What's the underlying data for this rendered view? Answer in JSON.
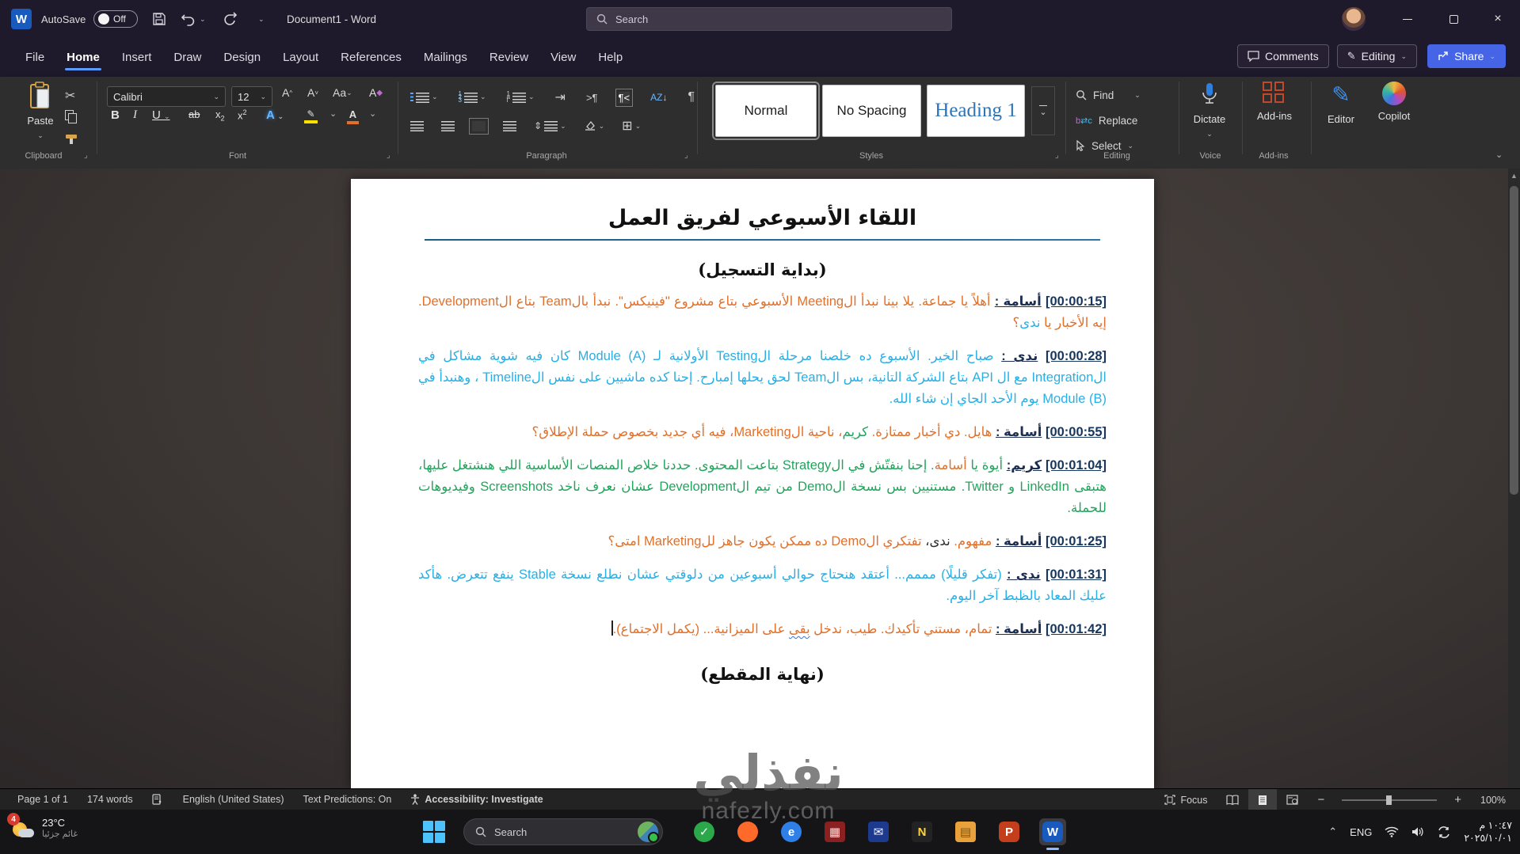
{
  "window": {
    "app_title": "Document1 - Word",
    "autosave_label": "AutoSave",
    "autosave_state": "Off",
    "search_placeholder": "Search",
    "word_badge": "W",
    "minimize": "–",
    "maximize": "▢",
    "close": "×"
  },
  "ribbon": {
    "tabs": [
      "File",
      "Home",
      "Insert",
      "Draw",
      "Design",
      "Layout",
      "References",
      "Mailings",
      "Review",
      "View",
      "Help"
    ],
    "active_tab": "Home",
    "comments_label": "Comments",
    "editing_mode_label": "Editing",
    "share_label": "Share",
    "paste_label": "Paste",
    "font_name": "Calibri",
    "font_size": "12",
    "styles": [
      {
        "label": "Normal",
        "selected": true
      },
      {
        "label": "No Spacing",
        "selected": false
      },
      {
        "label": "Heading 1",
        "selected": false,
        "heading": true
      }
    ],
    "editing_items": [
      "Find",
      "Replace",
      "Select"
    ],
    "dictate_label": "Dictate",
    "addins_label": "Add-ins",
    "editor_label": "Editor",
    "copilot_label": "Copilot",
    "group_labels": [
      "Clipboard",
      "Font",
      "Paragraph",
      "Styles",
      "Editing",
      "Voice",
      "Add-ins"
    ]
  },
  "document": {
    "title": "اللقاء الأسبوعي لفريق العمل",
    "section_start": "(بداية التسجيل)",
    "section_end": "(نهاية المقطع)",
    "paragraphs": [
      {
        "time": "[00:00:15]",
        "speaker": "أسامة :",
        "runs": [
          {
            "t": "أهلاً يا جماعة. يلا بينا نبدأ الMeeting الأسبوعي بتاع مشروع \"فينيكس\". نبدأ بالTeam بتاع الDevelopment. إيه الأخبار يا ",
            "c": "orange"
          },
          {
            "t": "ندى",
            "c": "cyan"
          },
          {
            "t": "؟",
            "c": "orange"
          }
        ]
      },
      {
        "time": "[00:00:28]",
        "speaker": "ندى :",
        "runs": [
          {
            "t": "صباح الخير. الأسبوع ده خلصنا مرحلة الTesting الأولانية لـ Module (A) كان فيه شوية مشاكل في الIntegration مع ال API بتاع الشركة التانية، بس الTeam لحق يحلها إمبارح. إحنا كده ماشيين على نفس الTimeline ، وهنبدأ في Module (B) يوم الأحد الجاي إن شاء الله.",
            "c": "cyan"
          }
        ]
      },
      {
        "time": "[00:00:55]",
        "speaker": "أسامة :",
        "runs": [
          {
            "t": "هايل. دي أخبار ممتازة. ",
            "c": "orange"
          },
          {
            "t": "كريم",
            "c": "green"
          },
          {
            "t": "، ناحية الMarketing، فيه أي جديد بخصوص حملة الإطلاق؟",
            "c": "orange"
          }
        ]
      },
      {
        "time": "[00:01:04]",
        "speaker": "كريم:",
        "runs": [
          {
            "t": "أيوة يا ",
            "c": "green"
          },
          {
            "t": "أسامة",
            "c": "orange"
          },
          {
            "t": ". إحنا بنفتّش في الStrategy بتاعت المحتوى. حددنا خلاص المنصات الأساسية اللي هنشتغل عليها، هتبقى LinkedIn و Twitter. مستنيين بس نسخة الDemo من تيم الDevelopment عشان نعرف ناخد Screenshots وفيديوهات للحملة.",
            "c": "green"
          }
        ]
      },
      {
        "time": "[00:01:25]",
        "speaker": "أسامة :",
        "runs": [
          {
            "t": "مفهوم. ",
            "c": "orange"
          },
          {
            "t": "ندى،",
            "c": "dark"
          },
          {
            "t": " تفتكري الDemo ده ممكن يكون جاهز للMarketing امتى؟",
            "c": "orange"
          }
        ]
      },
      {
        "time": "[00:01:31]",
        "speaker": "ندى :",
        "runs": [
          {
            "t": "(تفكر قليلًا) مممم... أعتقد هنحتاج حوالي أسبوعين من دلوقتي عشان نطلع نسخة Stable ينفع تتعرض. هأكد عليك المعاد بالظبط آخر اليوم.",
            "c": "cyan"
          }
        ]
      },
      {
        "time": "[00:01:42]",
        "speaker": "أسامة :",
        "cursor": true,
        "runs": [
          {
            "t": "تمام، مستني تأكيدك. طيب، ندخل ",
            "c": "orange"
          },
          {
            "t": "بقى",
            "c": "orange",
            "sq": true
          },
          {
            "t": " على الميزانية... (يكمل الاجتماع).",
            "c": "orange"
          }
        ]
      }
    ]
  },
  "status_bar": {
    "page": "Page 1 of 1",
    "words": "174 words",
    "language": "English (United States)",
    "predictions": "Text Predictions: On",
    "accessibility": "Accessibility: Investigate",
    "focus_label": "Focus",
    "zoom_level": "100%"
  },
  "taskbar": {
    "weather_temp": "23°C",
    "weather_desc": "غائم جزئيا",
    "notification_count": "4",
    "search_label": "Search",
    "apps": [
      {
        "name": "green-check-app-icon",
        "shape": "circle",
        "color": "#2ba84a",
        "glyph": "✓",
        "fg": "#fff"
      },
      {
        "name": "firefox-icon",
        "shape": "circle",
        "color": "#ff6a2a",
        "glyph": "",
        "fg": "#fff"
      },
      {
        "name": "edge-browser-icon",
        "shape": "circle",
        "color": "#2f7fe8",
        "glyph": "e",
        "fg": "#fff"
      },
      {
        "name": "store-grid-app-icon",
        "shape": "square",
        "color": "#8a2020",
        "glyph": "▦",
        "fg": "#ffd9d9"
      },
      {
        "name": "mail-app-icon",
        "shape": "square",
        "color": "#1d3a8f",
        "glyph": "✉",
        "fg": "#fff"
      },
      {
        "name": "dark-notes-app-icon",
        "shape": "square",
        "color": "#232323",
        "glyph": "N",
        "fg": "#ffd43b"
      },
      {
        "name": "files-app-icon",
        "shape": "square",
        "color": "#e9a23b",
        "glyph": "▤",
        "fg": "#7a5210"
      },
      {
        "name": "powerpoint-icon",
        "shape": "rounded",
        "color": "#c43e1c",
        "glyph": "P",
        "fg": "#fff"
      },
      {
        "name": "word-icon",
        "shape": "rounded",
        "color": "#185abd",
        "glyph": "W",
        "fg": "#fff",
        "active": true
      }
    ],
    "tray_lang": "ENG",
    "time": "١٠:٤٧ م",
    "date": "٢٠٢٥/١٠/٠١"
  },
  "watermark": {
    "arabic": "نفذلي",
    "latin": "nafezly.com"
  },
  "colors": {
    "accent_blue": "#5b9bff",
    "share_blue": "#4565e6",
    "word_blue": "#185abd"
  }
}
